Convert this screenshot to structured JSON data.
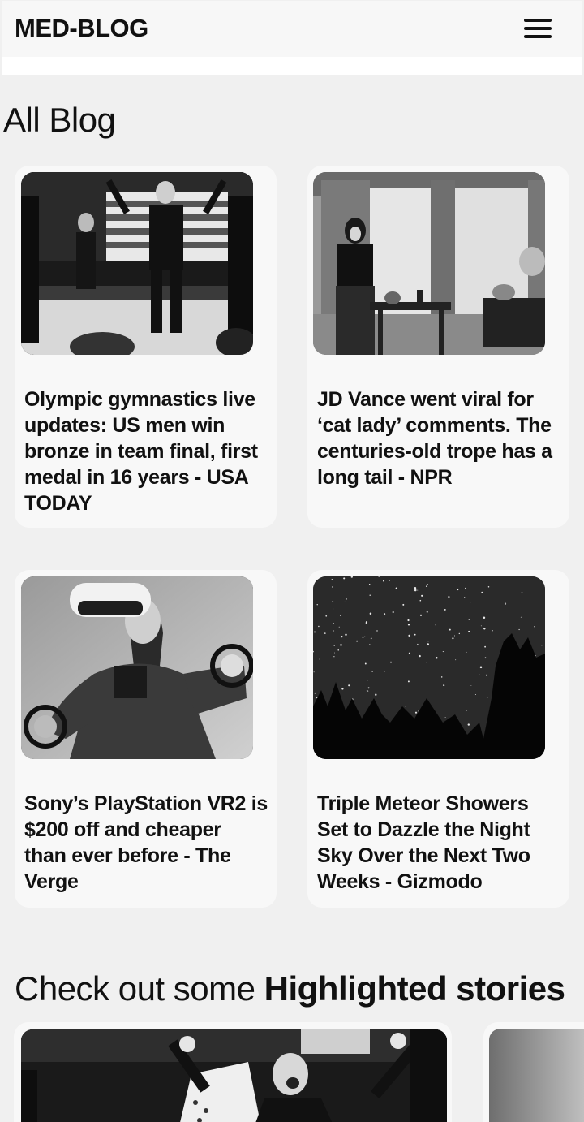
{
  "header": {
    "brand": "MED-BLOG",
    "menu_icon": "hamburger-menu-icon"
  },
  "all_blog": {
    "title": "All Blog",
    "posts": [
      {
        "title": "Olympic gymnastics live updates: US men win bronze in team final, first medal in 16 years - USA TODAY",
        "image": "gymnasts-celebrating-photo"
      },
      {
        "title": "JD Vance went viral for ‘cat lady’ comments. The centuries-old trope has a long tail - NPR",
        "image": "vintage-woman-with-cats-photo"
      },
      {
        "title": "Sony’s PlayStation VR2 is $200 off and cheaper than ever before - The Verge",
        "image": "woman-wearing-vr-headset-photo"
      },
      {
        "title": "Triple Meteor Showers Set to Dazzle the Night Sky Over the Next Two Weeks - Gizmodo",
        "image": "starry-night-sky-photo"
      }
    ]
  },
  "highlighted": {
    "title_prefix": "Check out some ",
    "title_bold": "Highlighted stories",
    "stories": [
      {
        "image": "gymnast-celebrating-photo"
      },
      {
        "image": "gray-photo"
      }
    ]
  },
  "colors": {
    "page_bg": "#f0f0f0",
    "card_bg": "#f8f8f8",
    "text": "#111111"
  }
}
